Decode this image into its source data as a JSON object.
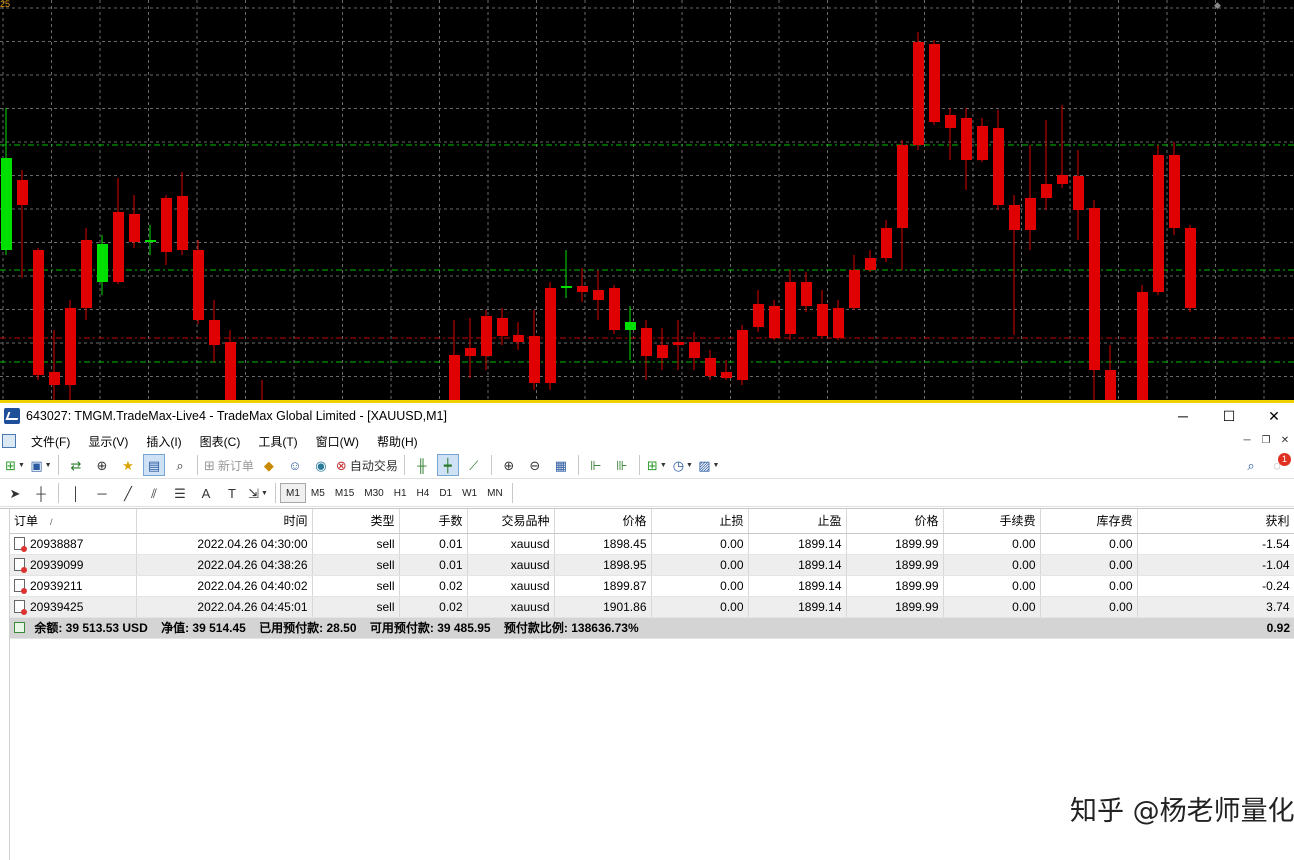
{
  "chart_top_label": "25",
  "window": {
    "title": "643027: TMGM.TradeMax-Live4 - TradeMax Global Limited - [XAUUSD,M1]",
    "minimize": "─",
    "maximize": "☐",
    "close": "✕"
  },
  "menu": [
    "文件(F)",
    "显示(V)",
    "插入(I)",
    "图表(C)",
    "工具(T)",
    "窗口(W)",
    "帮助(H)"
  ],
  "toolbar1": {
    "new_order": "新订单",
    "auto_trading": "自动交易",
    "notification_count": "1"
  },
  "timeframes": [
    "M1",
    "M5",
    "M15",
    "M30",
    "H1",
    "H4",
    "D1",
    "W1",
    "MN"
  ],
  "active_timeframe": "M1",
  "table": {
    "headers": [
      "订单",
      "/",
      "时间",
      "类型",
      "手数",
      "交易品种",
      "价格",
      "止损",
      "止盈",
      "价格",
      "手续费",
      "库存费",
      "获利"
    ],
    "rows": [
      {
        "order": "20938887",
        "time": "2022.04.26 04:30:00",
        "type": "sell",
        "lots": "0.01",
        "symbol": "xauusd",
        "open_price": "1898.45",
        "sl": "0.00",
        "tp": "1899.14",
        "price": "1899.99",
        "commission": "0.00",
        "swap": "0.00",
        "profit": "-1.54"
      },
      {
        "order": "20939099",
        "time": "2022.04.26 04:38:26",
        "type": "sell",
        "lots": "0.01",
        "symbol": "xauusd",
        "open_price": "1898.95",
        "sl": "0.00",
        "tp": "1899.14",
        "price": "1899.99",
        "commission": "0.00",
        "swap": "0.00",
        "profit": "-1.04"
      },
      {
        "order": "20939211",
        "time": "2022.04.26 04:40:02",
        "type": "sell",
        "lots": "0.02",
        "symbol": "xauusd",
        "open_price": "1899.87",
        "sl": "0.00",
        "tp": "1899.14",
        "price": "1899.99",
        "commission": "0.00",
        "swap": "0.00",
        "profit": "-0.24"
      },
      {
        "order": "20939425",
        "time": "2022.04.26 04:45:01",
        "type": "sell",
        "lots": "0.02",
        "symbol": "xauusd",
        "open_price": "1901.86",
        "sl": "0.00",
        "tp": "1899.14",
        "price": "1899.99",
        "commission": "0.00",
        "swap": "0.00",
        "profit": "3.74"
      }
    ],
    "summary": {
      "balance": "余额: 39 513.53 USD",
      "equity": "净值: 39 514.45",
      "margin": "已用预付款: 28.50",
      "free_margin": "可用预付款: 39 485.95",
      "margin_level": "预付款比例: 138636.73%",
      "total_profit": "0.92"
    }
  },
  "watermark": "知乎 @杨老师量化",
  "colors": {
    "bull": "#00e000",
    "bear": "#e00000",
    "grid": "#6a6a6a",
    "chart_bg": "#000000"
  }
}
